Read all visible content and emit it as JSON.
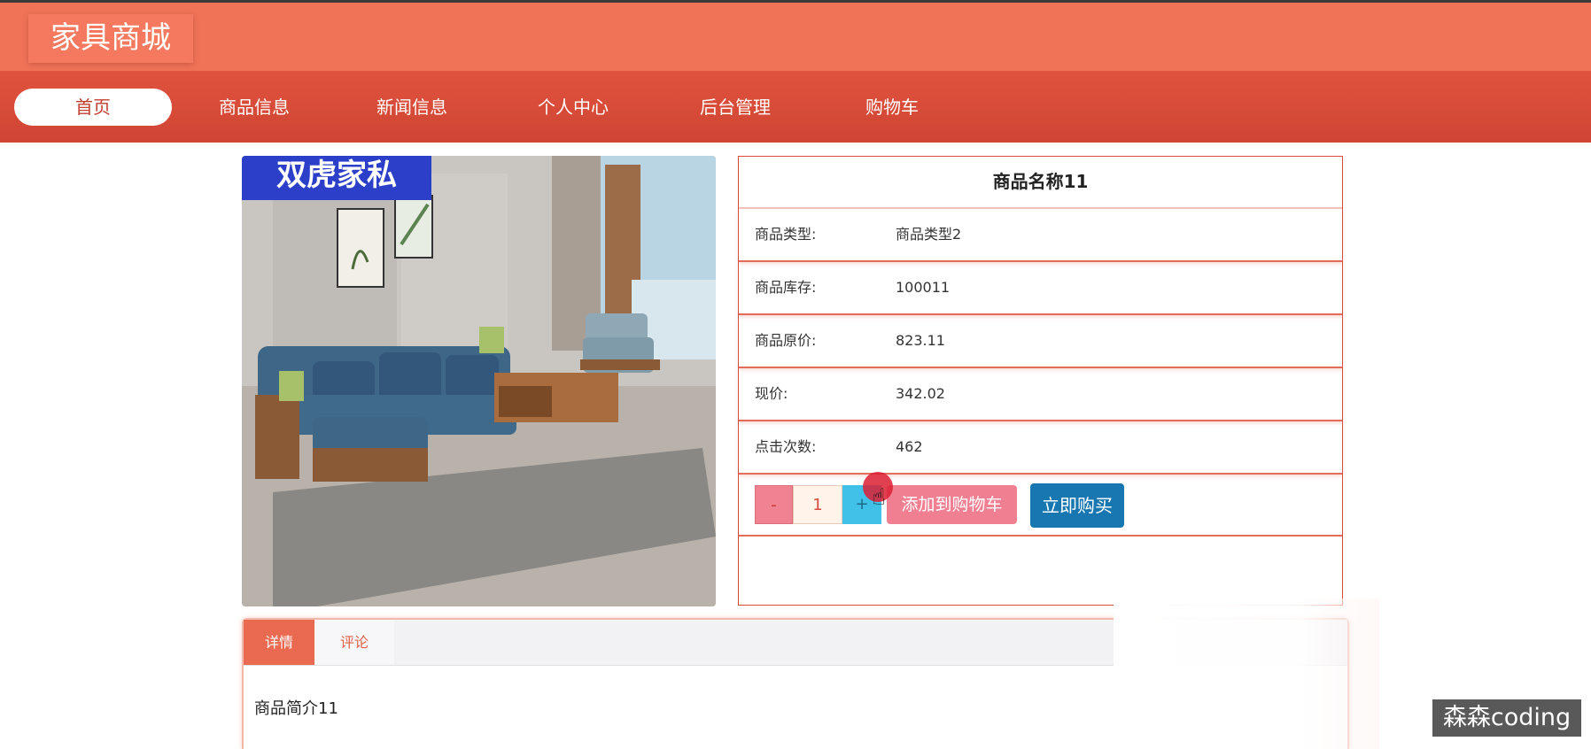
{
  "header": {
    "logo": "家具商城"
  },
  "nav": {
    "items": [
      {
        "label": "首页",
        "active": true
      },
      {
        "label": "商品信息"
      },
      {
        "label": "新闻信息"
      },
      {
        "label": "个人中心"
      },
      {
        "label": "后台管理"
      },
      {
        "label": "购物车"
      }
    ]
  },
  "product": {
    "image_brand": "双虎家私",
    "name": "商品名称11",
    "fields": [
      {
        "label": "商品类型:",
        "value": "商品类型2"
      },
      {
        "label": "商品库存:",
        "value": "100011"
      },
      {
        "label": "商品原价:",
        "value": "823.11"
      },
      {
        "label": "现价:",
        "value": "342.02"
      },
      {
        "label": "点击次数:",
        "value": "462"
      }
    ],
    "quantity": {
      "minus": "-",
      "value": "1",
      "plus": "+"
    },
    "add_to_cart": "添加到购物车",
    "buy_now": "立即购买"
  },
  "tabs": {
    "items": [
      {
        "label": "详情",
        "active": true
      },
      {
        "label": "评论"
      }
    ],
    "content": "商品简介11"
  },
  "watermark": "森森coding",
  "colors": {
    "header": "#f07357",
    "nav": "#d84a3c",
    "accent": "#ea6a51",
    "buy_button": "#1877b0",
    "cart_button": "#f08091",
    "plus_button": "#3fc1e8"
  }
}
